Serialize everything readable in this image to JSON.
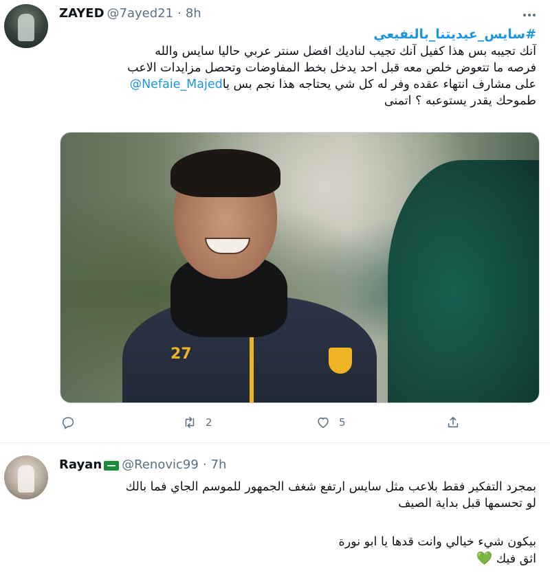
{
  "tweets": [
    {
      "author_name": "ZAYED",
      "handle": "@7ayed21",
      "separator": "·",
      "time": "8h",
      "hashtag": "#سايس_عيديتنا_بالنفيعي",
      "lines": [
        "آنك تجيبه بس هذا كفيل آنك تجيب لناديك افضل سنتر عربي حاليا سايس والله",
        "فرصه ما تتعوض خلص معه قبل احد يدخل بخط المفاوضات وتحصل مزايدات الاعب",
        "على مشارف انتهاء عقده وفر له كل شي يحتاجه هذا نجم بس يا",
        "طموحك يقدر يستوعبه ؟ اتمنى"
      ],
      "mention": "@Nefaie_Majed",
      "media_photo_text": "27",
      "actions": {
        "reply_icon": "reply-icon",
        "retweet_icon": "retweet-icon",
        "retweet_count": "2",
        "like_icon": "heart-icon",
        "like_count": "5",
        "share_icon": "share-icon"
      }
    },
    {
      "author_name": "Rayan",
      "flag_icon": "saudi-flag-icon",
      "handle": "@Renovic99",
      "separator": "·",
      "time": "7h",
      "lines": [
        "بمجرد التفكير فقط بلاعب مثل سايس ارتفع شغف الجمهور للموسم الجاي فما بالك",
        "لو تحسمها قبل بداية الصيف",
        "بيكون شيء خيالي وانت قدها يا ابو نورة",
        "اثق فيك"
      ],
      "heart_emoji": "💚"
    }
  ],
  "colors": {
    "link": "#1b95e0",
    "muted": "#5b7083",
    "text": "#0f1419",
    "separator": "#e6ecf0"
  }
}
